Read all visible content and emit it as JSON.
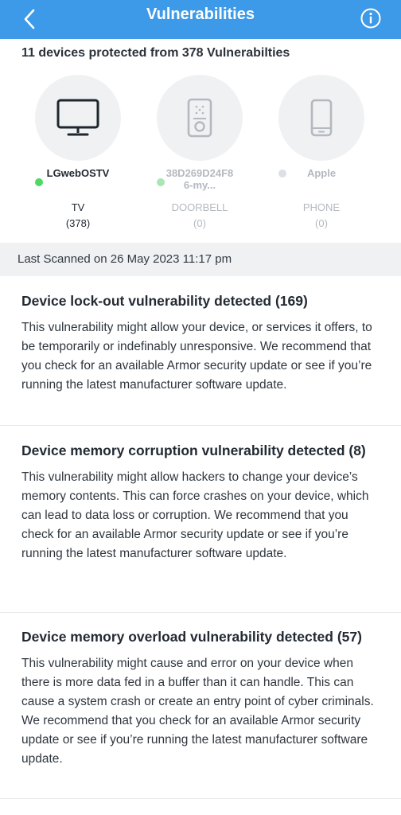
{
  "header": {
    "title": "Vulnerabilities",
    "back_icon": "chevron-left-icon",
    "info_icon": "info-circle-icon",
    "background": "#3d9ae8"
  },
  "summary": "11 devices protected from 378 Vulnerabilties",
  "devices": [
    {
      "name": "LGwebOSTV",
      "type": "TV",
      "count": "(378)",
      "icon": "monitor-icon",
      "status_color": "#4cd964",
      "active": true
    },
    {
      "name": "38D269D24F86-my...",
      "type": "DOORBELL",
      "count": "(0)",
      "icon": "doorbell-icon",
      "status_color": "#a8e6b4",
      "active": false
    },
    {
      "name": "Apple",
      "type": "PHONE",
      "count": "(0)",
      "icon": "phone-icon",
      "status_color": "#dcdfe3",
      "active": false
    }
  ],
  "last_scanned": "Last Scanned on 26 May 2023 11:17 pm",
  "vulnerabilities": [
    {
      "title": "Device lock-out vulnerability detected (169)",
      "description": "This vulnerability might allow your device, or services it offers, to be temporarily or indefinably unresponsive. We recommend that you check for an available Armor security update or see if you’re running the latest manufacturer software update."
    },
    {
      "title": "Device memory corruption vulnerability detected (8)",
      "description": "This vulnerability might allow hackers to change your device’s memory contents. This can force crashes on your device, which can lead to data loss or corruption. We recommend that you check for an available Armor security update or see if you’re running the latest manufacturer software update."
    },
    {
      "title": "Device memory overload vulnerability detected (57)",
      "description": "This vulnerability might cause and error on your device when there is more data fed in a buffer than it can handle. This can cause a system crash or create an entry point of cyber criminals. We recommend that you check for an available Armor security update or see if you’re running the latest manufacturer software update."
    }
  ]
}
